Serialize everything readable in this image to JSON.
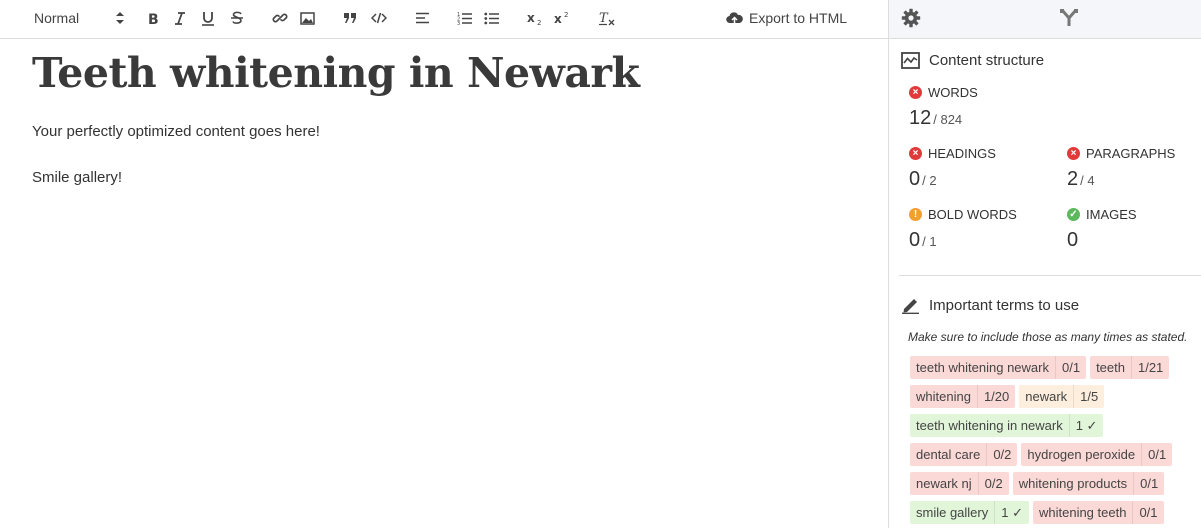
{
  "toolbar": {
    "format_value": "Normal",
    "export_label": "Export to HTML"
  },
  "document": {
    "title": "Teeth whitening in Newark",
    "paragraphs": [
      "Your perfectly optimized content goes here!",
      "Smile gallery!"
    ]
  },
  "sidebar": {
    "structure_title": "Content structure",
    "metrics": {
      "words": {
        "label": "WORDS",
        "value": "12",
        "target": "/ 824",
        "status": "red"
      },
      "headings": {
        "label": "HEADINGS",
        "value": "0",
        "target": "/ 2",
        "status": "red"
      },
      "paragraphs": {
        "label": "PARAGRAPHS",
        "value": "2",
        "target": "/ 4",
        "status": "red"
      },
      "bold_words": {
        "label": "BOLD WORDS",
        "value": "0",
        "target": "/ 1",
        "status": "orange"
      },
      "images": {
        "label": "IMAGES",
        "value": "0",
        "target": "",
        "status": "green"
      }
    },
    "terms_title": "Important terms to use",
    "terms_hint": "Make sure to include those as many times as stated.",
    "terms": [
      {
        "term": "teeth whitening newark",
        "count": "0/1",
        "status": "red"
      },
      {
        "term": "teeth",
        "count": "1/21",
        "status": "red"
      },
      {
        "term": "whitening",
        "count": "1/20",
        "status": "red"
      },
      {
        "term": "newark",
        "count": "1/5",
        "status": "orange"
      },
      {
        "term": "teeth whitening in newark",
        "count": "1 ✓",
        "status": "green"
      },
      {
        "term": "dental care",
        "count": "0/2",
        "status": "red"
      },
      {
        "term": "hydrogen peroxide",
        "count": "0/1",
        "status": "red"
      },
      {
        "term": "newark nj",
        "count": "0/2",
        "status": "red"
      },
      {
        "term": "whitening products",
        "count": "0/1",
        "status": "red"
      },
      {
        "term": "smile gallery",
        "count": "1 ✓",
        "status": "green"
      },
      {
        "term": "whitening teeth",
        "count": "0/1",
        "status": "red"
      }
    ]
  }
}
